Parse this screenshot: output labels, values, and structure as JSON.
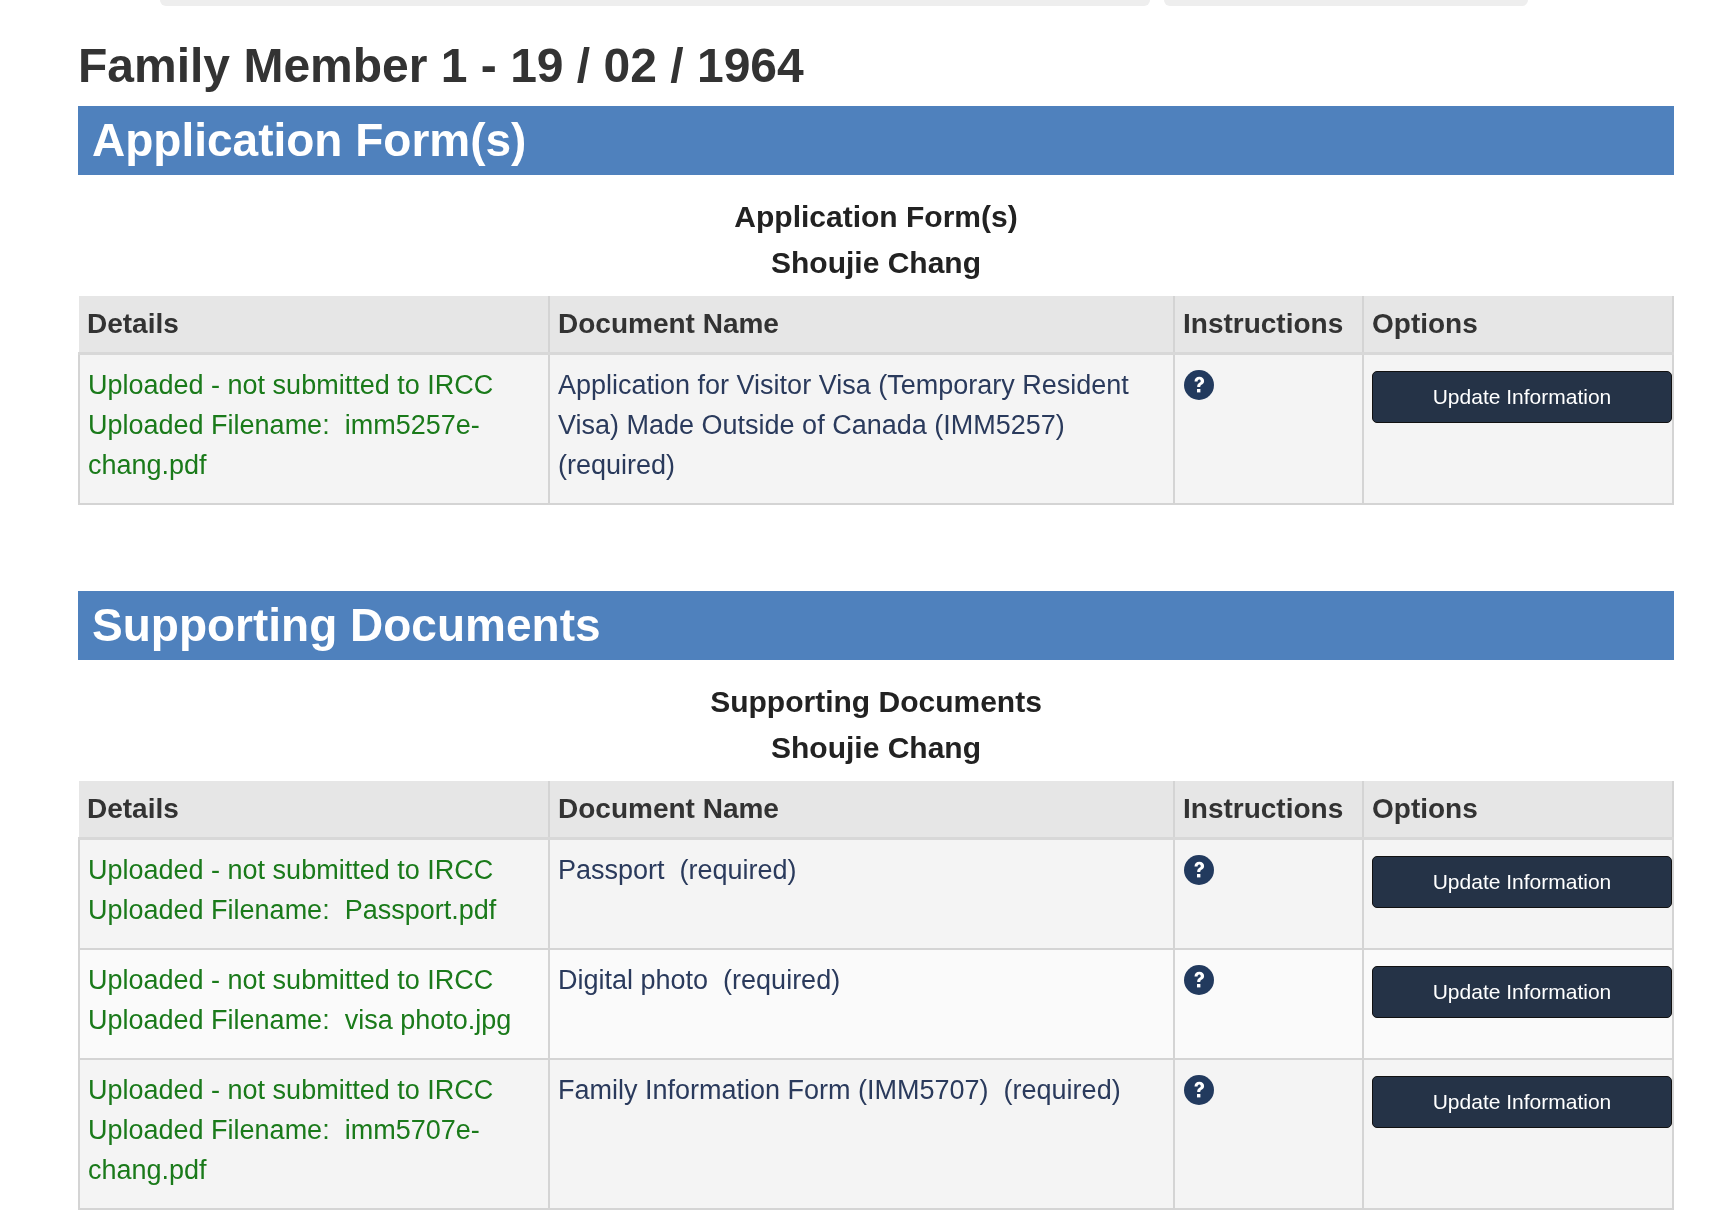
{
  "page_title": "Family Member 1 - 19 / 02 / 1964",
  "sections": [
    {
      "heading": "Application Form(s)",
      "subtitle": "Application Form(s)",
      "person": "Shoujie Chang",
      "columns": [
        "Details",
        "Document Name",
        "Instructions",
        "Options"
      ],
      "rows": [
        {
          "status": "Uploaded - not submitted to IRCC",
          "filename": "Uploaded Filename:  imm5257e-chang.pdf",
          "document": "Application for Visitor Visa (Temporary Resident Visa) Made Outside of Canada (IMM5257)  (required)",
          "button": "Update Information"
        }
      ]
    },
    {
      "heading": "Supporting Documents",
      "subtitle": "Supporting Documents",
      "person": "Shoujie Chang",
      "columns": [
        "Details",
        "Document Name",
        "Instructions",
        "Options"
      ],
      "rows": [
        {
          "status": "Uploaded - not submitted to IRCC",
          "filename": "Uploaded Filename:  Passport.pdf",
          "document": "Passport  (required)",
          "button": "Update Information"
        },
        {
          "status": "Uploaded - not submitted to IRCC",
          "filename": "Uploaded Filename:  visa photo.jpg",
          "document": "Digital photo  (required)",
          "button": "Update Information"
        },
        {
          "status": "Uploaded - not submitted to IRCC",
          "filename": "Uploaded Filename:  imm5707e-chang.pdf",
          "document": "Family Information Form (IMM5707)  (required)",
          "button": "Update Information"
        }
      ]
    }
  ]
}
